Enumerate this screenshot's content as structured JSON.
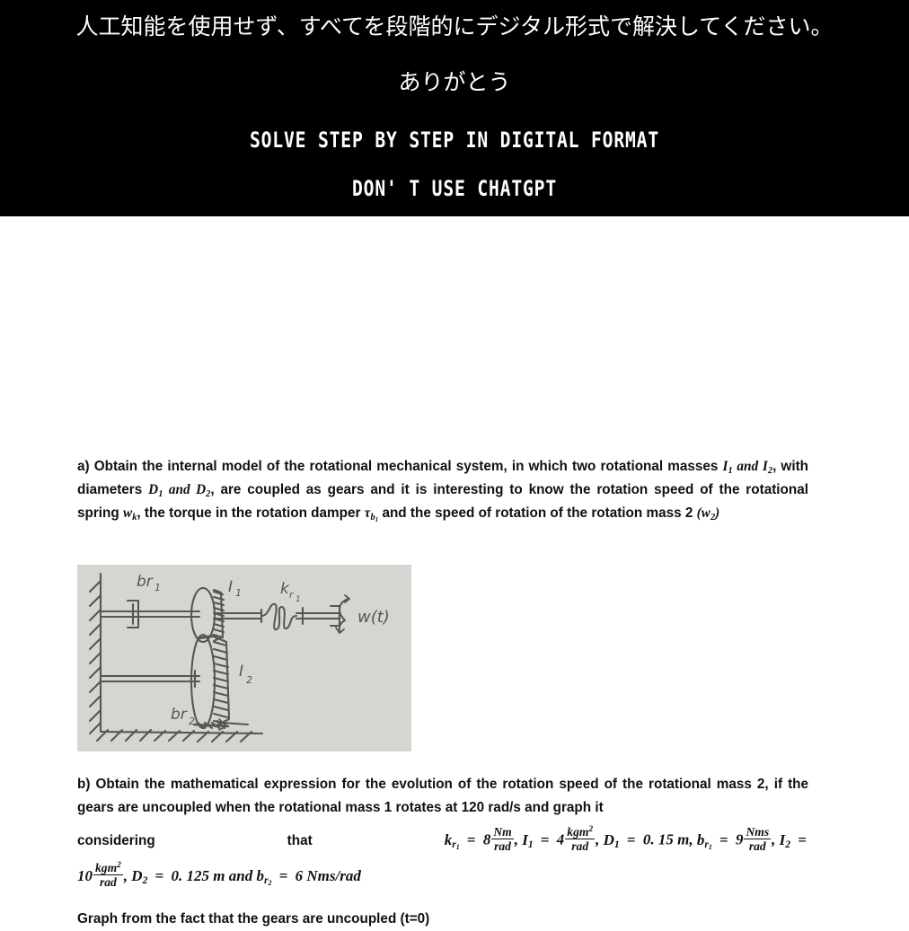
{
  "banner": {
    "background_color": "#000000",
    "text_color": "#ffffff",
    "line_jp_1": "人工知能を使用せず、すべてを段階的にデジタル形式で解決してください。",
    "line_jp_2": "ありがとう",
    "line_en_1": "SOLVE STEP BY STEP IN DIGITAL FORMAT",
    "line_en_2": "DON' T USE CHATGPT"
  },
  "document": {
    "background_color": "#ffffff",
    "text_color": "#111111",
    "part_a": {
      "marker": "a)",
      "text_1": "a) Obtain the internal model of the rotational mechanical system, in which two rotational masses",
      "text_2_pre": "",
      "I1": "I",
      "I1_sub": "1",
      "and_1": "and",
      "I2": "I",
      "I2_sub": "2",
      "text_3": ", with diameters",
      "D1": "D",
      "D1_sub": "1",
      "and_2": "and",
      "D2": "D",
      "D2_sub": "2",
      "text_4": ", are coupled as gears and it is interesting to know the",
      "text_5": "rotation speed of the rotational spring",
      "wk": "w",
      "wk_sub": "k",
      "text_6": ", the torque in the rotation damper",
      "tau": "τ",
      "tau_sub": "b",
      "tau_sub_sub": "1",
      "text_7": "and the speed",
      "text_8": "of rotation of the rotation mass 2",
      "w2_open": "(",
      "w2": "w",
      "w2_sub": "2",
      "w2_close": ")"
    },
    "part_b": {
      "text_1": "b) Obtain the mathematical expression for the evolution of the rotation speed of the rotational",
      "text_2": "mass 2, if the gears are uncoupled when the rotational mass 1 rotates at 120 rad/s and graph it",
      "considering": "considering",
      "that": "that",
      "eq": {
        "k_sym": "k",
        "k_sub": "r",
        "k_sub_sub": "1",
        "eq1_op": "=",
        "k_value": "8",
        "k_unit_num": "Nm",
        "k_unit_den": "rad",
        "comma1": ",",
        "I1_sym": "I",
        "I1_sub": "1",
        "eq2_op": "=",
        "I1_value": "4",
        "I1_unit_num": "kgm",
        "I1_unit_num_sup": "2",
        "I1_unit_den": "rad",
        "comma2": ",",
        "D1_sym": "D",
        "D1_sub": "1",
        "eq3_op": "=",
        "D1_value": "0. 15 m",
        "comma3": ",",
        "b_sym": "b",
        "b_sub": "r",
        "b_sub_sub": "1",
        "eq4_op": "=",
        "b_value": "9",
        "b_unit_num": "Nms",
        "b_unit_den": "rad",
        "comma4": ",",
        "I2_sym": "I",
        "I2_sub": "2",
        "eq5_op": "=",
        "I2_value": "10",
        "I2_unit_num": "kgm",
        "I2_unit_num_sup": "2",
        "I2_unit_den": "rad",
        "comma5": ",",
        "D2_sym": "D",
        "D2_sub": "2",
        "eq6_op": "=",
        "D2_value": "0. 125 m",
        "and_word": "and",
        "b2_sym": "b",
        "b2_sub": "r",
        "b2_sub_sub": "2",
        "eq7_op": "=",
        "b2_value": "6 Nms/rad"
      },
      "graph_note": "Graph from the fact that the gears are uncoupled (t=0)"
    }
  },
  "figure": {
    "caption_free": true,
    "paper_color": "#d6d5d1",
    "ink_color": "#4a4a48",
    "labels": {
      "damper_1": "br₁",
      "inertia_1": "I₁",
      "spring": "kr₁",
      "input": "w(t)",
      "inertia_2": "I₂",
      "damper_2": "br₂"
    },
    "parts": [
      "fixed-wall-hatching",
      "rotational-damper-1",
      "shaft-1",
      "gear-1",
      "rotational-spring",
      "input-torque-source",
      "gear-2",
      "shaft-2",
      "rotational-damper-2",
      "ground-hatching"
    ]
  }
}
